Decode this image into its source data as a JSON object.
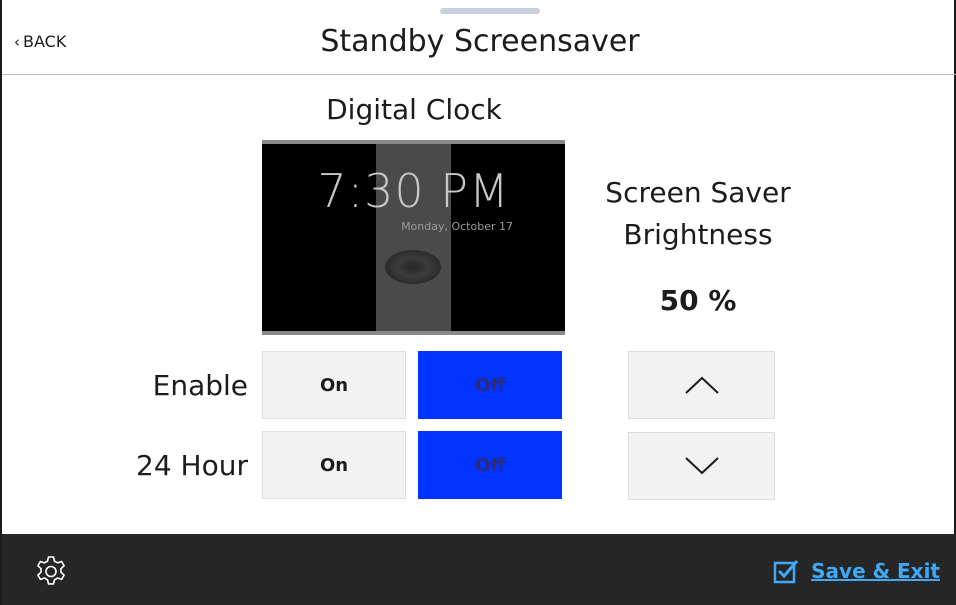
{
  "header": {
    "back_label": "BACK",
    "title": "Standby Screensaver"
  },
  "preview": {
    "label": "Digital Clock",
    "time": "7:30 PM",
    "date": "Monday, October 17"
  },
  "enable": {
    "label": "Enable",
    "on_label": "On",
    "off_label": "Off",
    "selected": "Off"
  },
  "hour24": {
    "label": "24 Hour",
    "on_label": "On",
    "off_label": "Off",
    "selected": "Off"
  },
  "brightness": {
    "label": "Screen Saver Brightness",
    "value": "50 %",
    "up_icon": "chevron-up-icon",
    "down_icon": "chevron-down-icon"
  },
  "footer": {
    "settings_icon": "gear-icon",
    "save_label": "Save & Exit",
    "save_icon": "checkbox-checked-icon"
  },
  "colors": {
    "selected_button": "#0033ff",
    "footer_bg": "#262626",
    "link": "#3fa9f5"
  }
}
